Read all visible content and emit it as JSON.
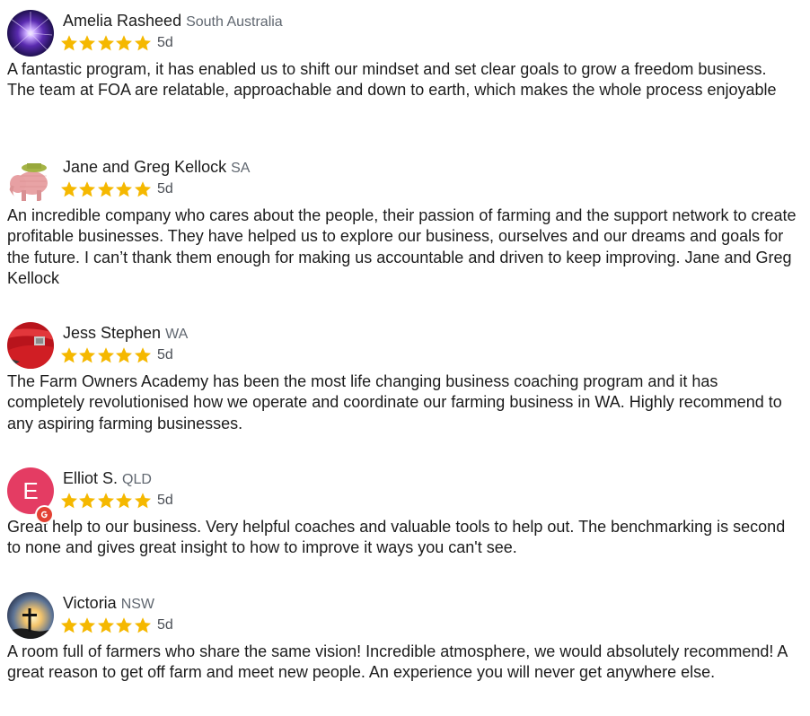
{
  "colors": {
    "star": "#f5b800",
    "text": "#1c1c1c",
    "muted": "#606770",
    "letter_avatar": "#e43c63",
    "google_red": "#e34133"
  },
  "reviews": [
    {
      "name": "Amelia Rasheed",
      "location": "South Australia",
      "rating": 5,
      "age": "5d",
      "avatar": "purple-light-burst-photo",
      "text": "A fantastic program, it has enabled us to shift our mindset and set clear goals to grow a freedom business. The team at FOA are relatable, approachable and down to earth, which makes the whole process enjoyable"
    },
    {
      "name": "Jane and Greg Kellock",
      "location": "SA",
      "rating": 5,
      "age": "5d",
      "avatar": "pink-elephant-photo",
      "text": "An incredible company who cares about the people, their passion of farming and the support network to create profitable businesses. They have helped us to explore our business, ourselves and our dreams and goals for the future. I can’t thank them enough for making us accountable and driven to keep improving. Jane and Greg Kellock"
    },
    {
      "name": "Jess Stephen",
      "location": "WA",
      "rating": 5,
      "age": "5d",
      "avatar": "red-vehicle-photo",
      "text": "The Farm Owners Academy has been the most life changing business coaching program and it has completely revolutionised how we operate and coordinate our farming business in WA. Highly recommend to any aspiring farming businesses."
    },
    {
      "name": "Elliot S.",
      "location": "QLD",
      "rating": 5,
      "age": "5d",
      "avatar": "letter-e-avatar",
      "avatar_letter": "E",
      "badge": "google-g-icon",
      "text": "Great help to our business. Very helpful coaches and valuable tools to help out. The benchmarking is second to none and gives great insight to how to improve it ways you can't see."
    },
    {
      "name": "Victoria",
      "location": "NSW",
      "rating": 5,
      "age": "5d",
      "avatar": "cross-at-sunset-photo",
      "text": "A room full of farmers who share the same vision! Incredible atmosphere, we would absolutely recommend! A great reason to get off farm and meet new people. An experience you will never get anywhere else."
    }
  ]
}
